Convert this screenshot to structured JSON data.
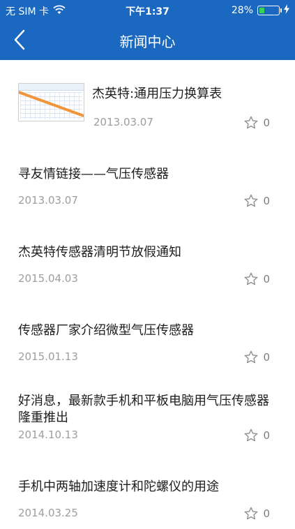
{
  "status_bar": {
    "carrier": "无 SIM 卡",
    "time": "下午1:37",
    "battery_percent": "28%",
    "battery_level": 0.28,
    "wifi_icon": "wifi-icon",
    "charging_icon": "bolt-icon"
  },
  "nav": {
    "title": "新闻中心",
    "back_icon": "chevron-left-icon"
  },
  "colors": {
    "header": "#1b68c1",
    "title_text": "#1d1d1d",
    "muted_text": "#9e9e9e"
  },
  "news": [
    {
      "title": "杰英特:通用压力换算表",
      "date": "2013.03.07",
      "favorites": "0",
      "has_thumbnail": true
    },
    {
      "title": "寻友情链接——气压传感器",
      "date": "2013.03.07",
      "favorites": "0"
    },
    {
      "title": "杰英特传感器清明节放假通知",
      "date": "2015.04.03",
      "favorites": "0"
    },
    {
      "title": "传感器厂家介绍微型气压传感器",
      "date": "2015.01.13",
      "favorites": "0"
    },
    {
      "title": "好消息，最新款手机和平板电脑用气压传感器隆重推出",
      "date": "2014.10.13",
      "favorites": "0"
    },
    {
      "title": "手机中两轴加速度计和陀螺仪的用途",
      "date": "2014.03.25",
      "favorites": "0"
    }
  ]
}
